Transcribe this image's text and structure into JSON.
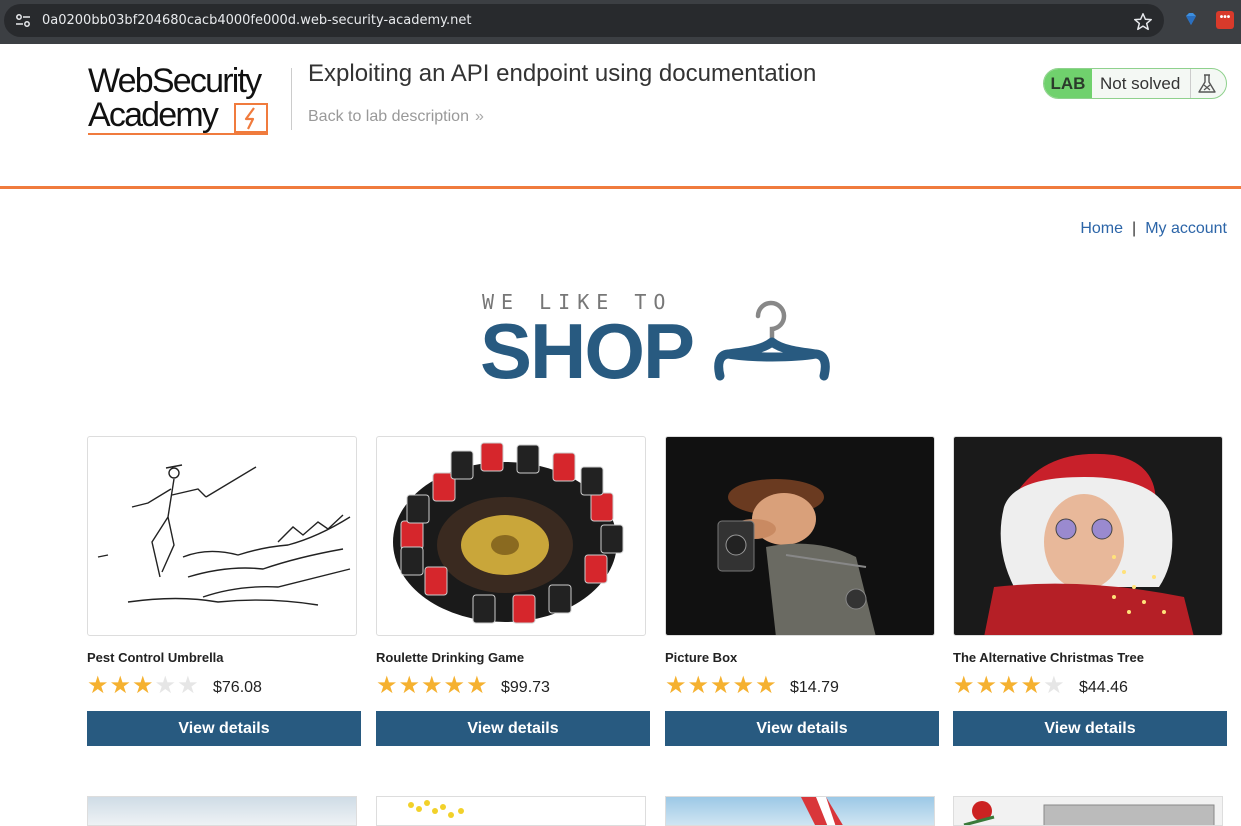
{
  "browser": {
    "url": "0a0200bb03bf204680cacb4000fe000d.web-security-academy.net"
  },
  "lab_header": {
    "logo_line1": "WebSecurity",
    "logo_line2": "Academy",
    "title": "Exploiting an API endpoint using documentation",
    "back_link": "Back to lab description",
    "badge": "LAB",
    "status": "Not solved"
  },
  "nav": {
    "home": "Home",
    "separator": "|",
    "account": "My account"
  },
  "banner": {
    "small": "WE LIKE TO",
    "big": "SHOP"
  },
  "products": [
    {
      "name": "Pest Control Umbrella",
      "price": "$76.08",
      "rating": 3,
      "button": "View details"
    },
    {
      "name": "Roulette Drinking Game",
      "price": "$99.73",
      "rating": 5,
      "button": "View details"
    },
    {
      "name": "Picture Box",
      "price": "$14.79",
      "rating": 5,
      "button": "View details"
    },
    {
      "name": "The Alternative Christmas Tree",
      "price": "$44.46",
      "rating": 4,
      "button": "View details"
    }
  ],
  "colors": {
    "accent_orange": "#f07b3d",
    "button_blue": "#285a80",
    "link_blue": "#2c65a8",
    "lab_green": "#70d16d",
    "star_gold": "#f5b130"
  }
}
